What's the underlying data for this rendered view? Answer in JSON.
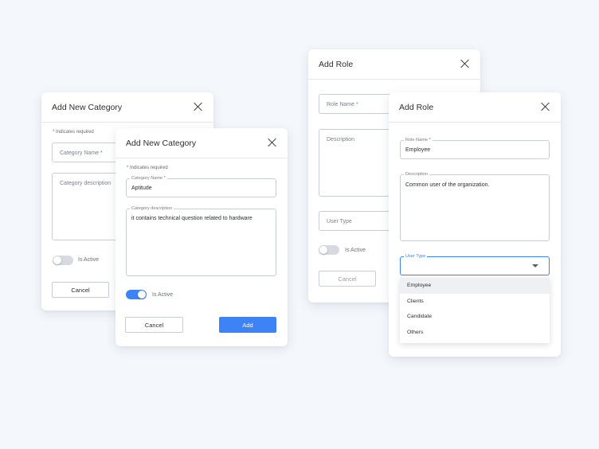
{
  "category_back": {
    "title": "Add New Category",
    "required_note": "* Indicates required",
    "name_placeholder": "Category Name *",
    "desc_placeholder": "Category description",
    "active_label": "Is Active",
    "active": false,
    "cancel_label": "Cancel"
  },
  "category_front": {
    "title": "Add New Category",
    "required_note": "* Indicates required",
    "name_label": "Category Name *",
    "name_value": "Aptitude",
    "desc_label": "Category description",
    "desc_value": "it contains technical question related to hardware",
    "active_label": "Is Active",
    "active": true,
    "cancel_label": "Cancel",
    "add_label": "Add"
  },
  "role_back": {
    "title": "Add Role",
    "name_placeholder": "Role Name *",
    "desc_placeholder": "Description",
    "type_placeholder": "User Type",
    "active_label": "Is Active",
    "active": false,
    "cancel_label": "Cancel"
  },
  "role_front": {
    "title": "Add Role",
    "name_label": "Role Name *",
    "name_value": "Employee",
    "desc_label": "Description",
    "desc_value": "Common user of the organization.",
    "type_label": "User Type",
    "type_options": [
      "Employee",
      "Clients",
      "Candidate",
      "Others"
    ],
    "highlighted_option": "Employee"
  },
  "colors": {
    "accent": "#3d83f5",
    "background": "#f4f7fb"
  }
}
